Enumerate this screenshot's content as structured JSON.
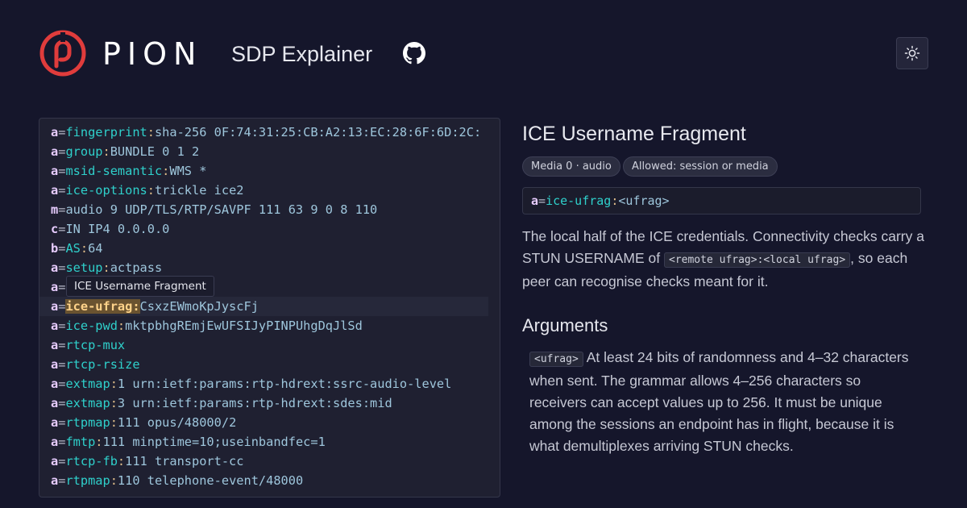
{
  "header": {
    "brand": "PION",
    "app_title": "SDP Explainer",
    "github_icon": "github-icon",
    "theme_icon": "sun-icon",
    "brand_color": "#e03c3c"
  },
  "sdp_lines": [
    {
      "type": "a",
      "attr": "fingerprint",
      "value": "sha-256 0F:74:31:25:CB:A2:13:EC:28:6F:6D:2C:"
    },
    {
      "type": "a",
      "attr": "group",
      "value": "BUNDLE 0 1 2"
    },
    {
      "type": "a",
      "attr": "msid-semantic",
      "value": "WMS *"
    },
    {
      "type": "a",
      "attr": "ice-options",
      "value": "trickle ice2"
    },
    {
      "type": "m",
      "attr": "",
      "value": "audio 9 UDP/TLS/RTP/SAVPF 111 63 9 0 8 110"
    },
    {
      "type": "c",
      "attr": "",
      "value": "IN IP4 0.0.0.0"
    },
    {
      "type": "b",
      "attr": "AS",
      "value": "64"
    },
    {
      "type": "a",
      "attr": "setup",
      "value": "actpass"
    },
    {
      "type": "a",
      "attr": "",
      "value": ""
    },
    {
      "type": "a",
      "attr": "ice-ufrag",
      "value": "CsxzEWmoKpJyscFj",
      "active": true
    },
    {
      "type": "a",
      "attr": "ice-pwd",
      "value": "mktpbhgREmjEwUFSIJyPINPUhgDqJlSd"
    },
    {
      "type": "a",
      "attr": "rtcp-mux",
      "value": "",
      "flag": true
    },
    {
      "type": "a",
      "attr": "rtcp-rsize",
      "value": "",
      "flag": true
    },
    {
      "type": "a",
      "attr": "extmap",
      "value": "1 urn:ietf:params:rtp-hdrext:ssrc-audio-level"
    },
    {
      "type": "a",
      "attr": "extmap",
      "value": "3 urn:ietf:params:rtp-hdrext:sdes:mid"
    },
    {
      "type": "a",
      "attr": "rtpmap",
      "value": "111 opus/48000/2"
    },
    {
      "type": "a",
      "attr": "fmtp",
      "value": "111 minptime=10;useinbandfec=1"
    },
    {
      "type": "a",
      "attr": "rtcp-fb",
      "value": "111 transport-cc"
    },
    {
      "type": "a",
      "attr": "rtpmap",
      "value": "110 telephone-event/48000"
    }
  ],
  "tooltip": "ICE Username Fragment",
  "detail": {
    "title": "ICE Username Fragment",
    "badges": [
      "Media 0 · audio",
      "Allowed: session or media"
    ],
    "syntax_prefix": "a",
    "syntax_attr": "ice-ufrag",
    "syntax_arg": "<ufrag>",
    "desc_before": "The local half of the ICE credentials. Connectivity checks carry a STUN USERNAME of ",
    "desc_code": "<remote ufrag>:<local ufrag>",
    "desc_after": ", so each peer can recognise checks meant for it.",
    "args_title": "Arguments",
    "arg_name": "<ufrag>",
    "arg_desc": " At least 24 bits of randomness and 4–32 characters when sent. The grammar allows 4–256 characters so receivers can accept values up to 256. It must be unique among the sessions an endpoint has in flight, because it is what demultiplexes arriving STUN checks."
  }
}
